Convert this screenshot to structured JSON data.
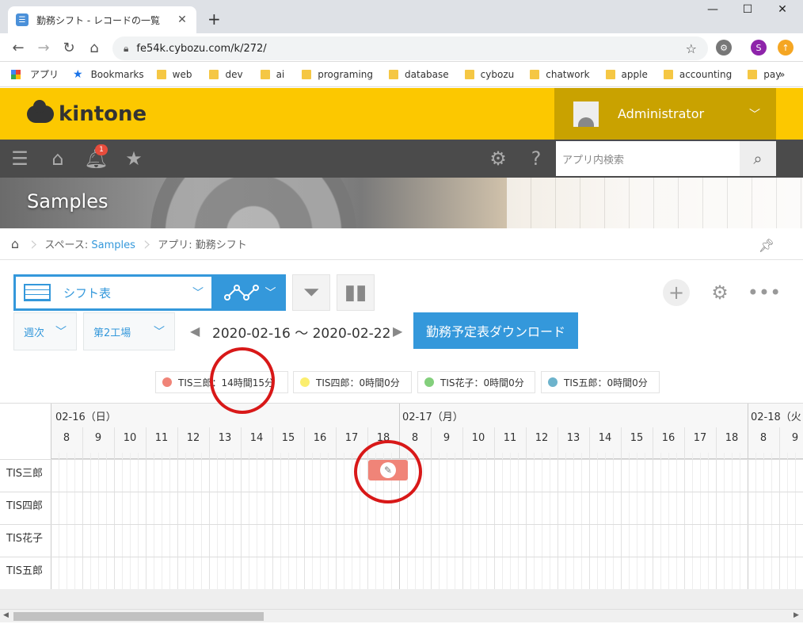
{
  "browser": {
    "tab_title": "勤務シフト - レコードの一覧",
    "url": "fe54k.cybozu.com/k/272/",
    "profile_initial": "S",
    "bookmarks": [
      "アプリ",
      "Bookmarks",
      "web",
      "dev",
      "ai",
      "programing",
      "database",
      "cybozu",
      "chatwork",
      "apple",
      "accounting",
      "pay"
    ],
    "more_bookmarks": "»"
  },
  "header": {
    "logo": "kintone",
    "user": "Administrator",
    "notifications": "1",
    "search_placeholder": "アプリ内検索"
  },
  "space": {
    "title": "Samples"
  },
  "breadcrumb": {
    "space_label": "スペース: ",
    "space_name": "Samples",
    "app_label": "アプリ: 勤務シフト"
  },
  "toolbar": {
    "view_name": "シフト表",
    "period": "週次",
    "location": "第2工場",
    "date_range": "2020-02-16 〜 2020-02-22",
    "download_label": "勤務予定表ダウンロード"
  },
  "legend": [
    {
      "text": "TIS三郎：14時間15分",
      "color": "#f08478"
    },
    {
      "text": "TIS四郎：0時間0分",
      "color": "#fbee6e"
    },
    {
      "text": "TIS花子：0時間0分",
      "color": "#83cf7c"
    },
    {
      "text": "TIS五郎：0時間0分",
      "color": "#6db3cc"
    }
  ],
  "calendar": {
    "days": [
      "02-16（日）",
      "02-17（月）",
      "02-18（火"
    ],
    "hours_day1": [
      "8",
      "9",
      "10",
      "11",
      "12",
      "13",
      "14",
      "15",
      "16",
      "17",
      "18"
    ],
    "hours_day2": [
      "8",
      "9",
      "10",
      "11",
      "12",
      "13",
      "14",
      "15",
      "16",
      "17",
      "18"
    ],
    "hours_day3": [
      "8",
      "9"
    ],
    "people": [
      "TIS三郎",
      "TIS四郎",
      "TIS花子",
      "TIS五郎"
    ]
  }
}
